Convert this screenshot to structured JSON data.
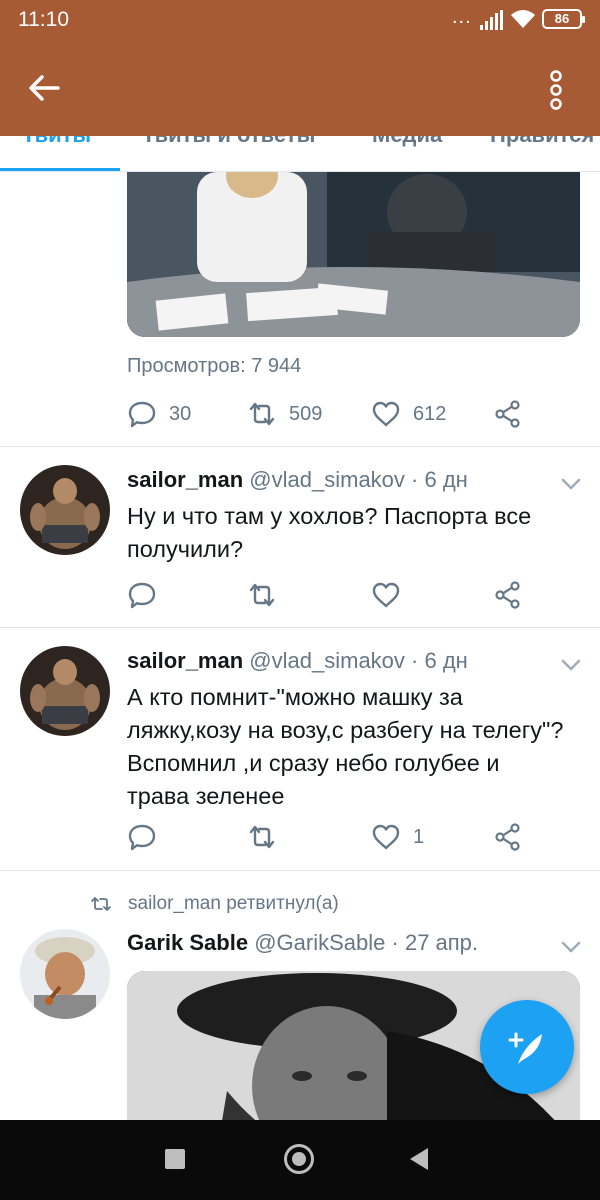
{
  "status_bar": {
    "time": "11:10",
    "dots": "...",
    "battery": "86"
  },
  "app_bar": {
    "background": "#a65b35"
  },
  "tabs": [
    {
      "label": "Твиты",
      "active": true
    },
    {
      "label": "Твиты и ответы",
      "active": false
    },
    {
      "label": "Медиа",
      "active": false
    },
    {
      "label": "Нравится",
      "active": false
    }
  ],
  "first_tweet": {
    "views": "Просмотров: 7 944",
    "replies": "30",
    "retweets": "509",
    "likes": "612"
  },
  "tweets": [
    {
      "name": "sailor_man",
      "handle": "@vlad_simakov",
      "time": "6 дн",
      "text": "Ну и что там у хохлов? Паспорта все получили?",
      "likes": ""
    },
    {
      "name": "sailor_man",
      "handle": "@vlad_simakov",
      "time": "6 дн",
      "text": "А кто помнит-\"можно машку за ляжку,козу на возу,с разбегу на телегу\"? Вспомнил ,и сразу небо голубее и трава зеленее",
      "likes": "1"
    }
  ],
  "retweet": {
    "label": "sailor_man ретвитнул(а)",
    "name": "Garik Sable",
    "handle": "@GarikSable",
    "time": "27 апр."
  },
  "colors": {
    "accent": "#1da1f2",
    "secondary_text": "#657786",
    "header": "#a65b35"
  }
}
